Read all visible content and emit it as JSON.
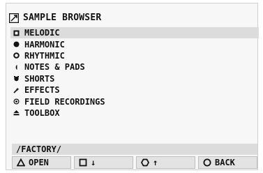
{
  "browser": {
    "title": "SAMPLE BROWSER",
    "title_icon": "browser-window-icon",
    "items": [
      {
        "label": "MELODIC",
        "icon": "square-icon",
        "selected": true
      },
      {
        "label": "HARMONIC",
        "icon": "filled-circle-icon",
        "selected": false
      },
      {
        "label": "RHYTHMIC",
        "icon": "ring-icon",
        "selected": false
      },
      {
        "label": "NOTES & PADS",
        "icon": "notes-icon",
        "selected": false
      },
      {
        "label": "SHORTS",
        "icon": "shorts-icon",
        "selected": false
      },
      {
        "label": "EFFECTS",
        "icon": "effects-icon",
        "selected": false
      },
      {
        "label": "FIELD RECORDINGS",
        "icon": "field-icon",
        "selected": false
      },
      {
        "label": "TOOLBOX",
        "icon": "eject-icon",
        "selected": false
      }
    ],
    "path": "/FACTORY/"
  },
  "buttons": [
    {
      "label": "OPEN",
      "icon": "triangle-icon"
    },
    {
      "label": "↓",
      "icon": "square-outline-icon"
    },
    {
      "label": "↑",
      "icon": "hexagon-icon"
    },
    {
      "label": "BACK",
      "icon": "circle-outline-icon"
    }
  ]
}
